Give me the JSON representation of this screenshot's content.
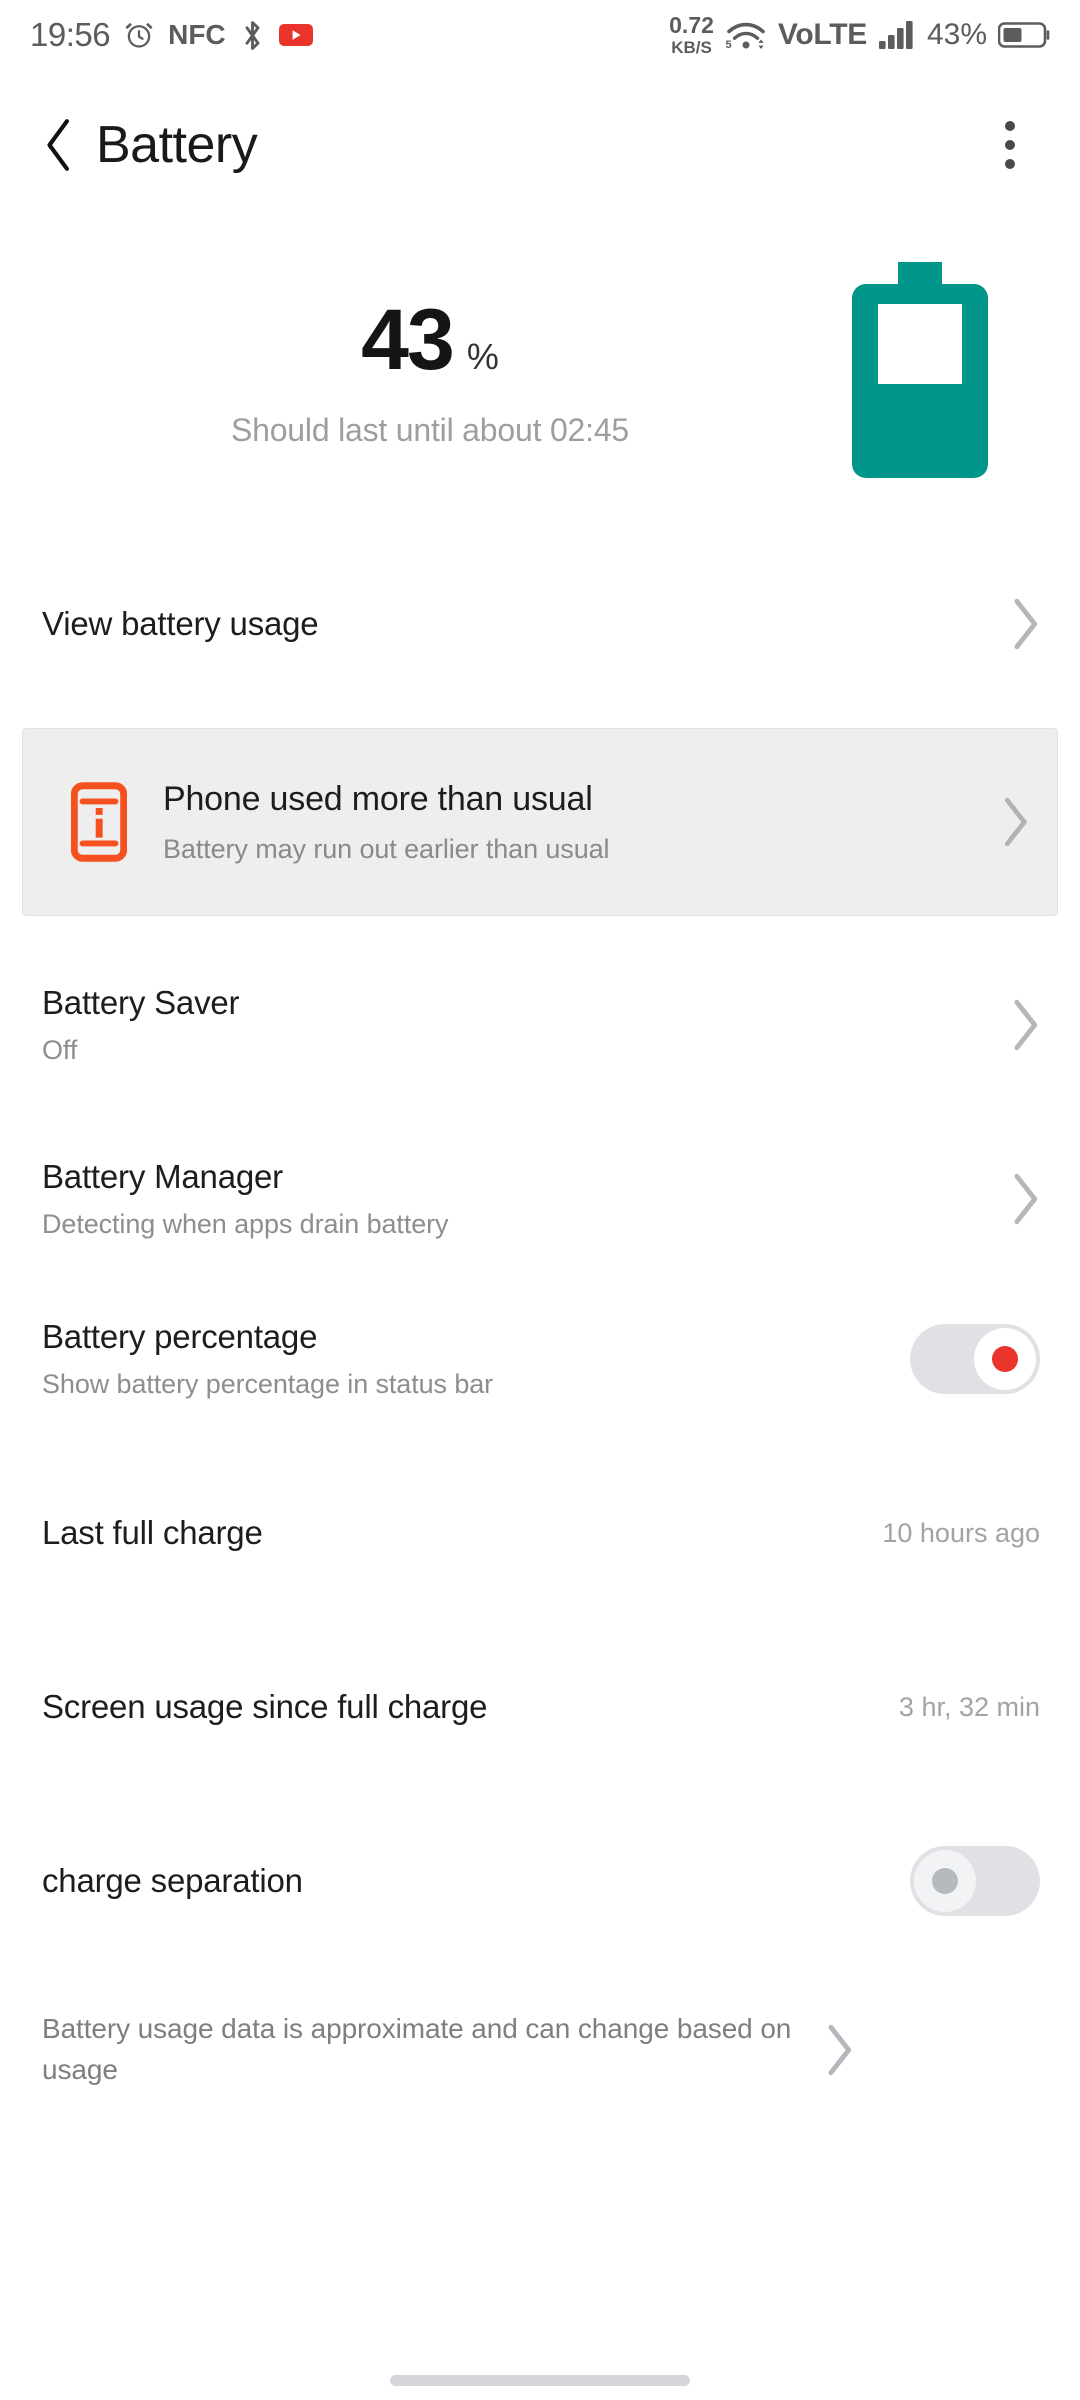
{
  "status_bar": {
    "time": "19:56",
    "alarm_icon": "alarm-clock-icon",
    "nfc_label": "NFC",
    "bluetooth_icon": "bluetooth-icon",
    "youtube_icon": "youtube-icon",
    "net_speed_value": "0.72",
    "net_speed_unit": "KB/S",
    "wifi_icon": "wifi-icon",
    "wifi_band": "5",
    "network_label": "VoLTE",
    "signal_icon": "cellular-signal-icon",
    "battery_percent": "43%",
    "battery_icon": "battery-icon"
  },
  "app_bar": {
    "back_icon": "chevron-left-icon",
    "title": "Battery",
    "overflow_icon": "more-vertical-icon"
  },
  "hero": {
    "percent_value": "43",
    "percent_symbol": "%",
    "estimate": "Should last until about 02:45",
    "battery_graphic": "battery-level-icon",
    "battery_color": "#00968B",
    "battery_fill_ratio": 0.43
  },
  "usage_link": {
    "label": "View battery usage",
    "chevron": "chevron-right-icon"
  },
  "warning_card": {
    "icon": "battery-alert-icon",
    "icon_color": "#F4511E",
    "background": "#EEEEEE",
    "title": "Phone used more than usual",
    "subtitle": "Battery may run out earlier than usual",
    "chevron": "chevron-right-icon"
  },
  "settings": [
    {
      "name": "battery-saver",
      "title": "Battery Saver",
      "subtitle": "Off",
      "type": "link",
      "chevron": "chevron-right-icon"
    },
    {
      "name": "battery-manager",
      "title": "Battery Manager",
      "subtitle": "Detecting when apps drain battery",
      "type": "link",
      "chevron": "chevron-right-icon"
    },
    {
      "name": "battery-percentage",
      "title": "Battery percentage",
      "subtitle": "Show battery percentage in status bar",
      "type": "toggle",
      "toggle_state": "on"
    },
    {
      "name": "last-full-charge",
      "title": "Last full charge",
      "value": "10 hours ago",
      "type": "value"
    },
    {
      "name": "screen-usage-since-full-charge",
      "title": "Screen usage since full charge",
      "value": "3 hr, 32 min",
      "type": "value"
    },
    {
      "name": "charge-separation",
      "title": "charge separation",
      "type": "toggle",
      "toggle_state": "off"
    }
  ],
  "footer": {
    "note": "Battery usage data is approximate and can change based on usage",
    "chevron": "chevron-right-icon"
  },
  "colors": {
    "accent_teal": "#00968B",
    "warning_orange": "#F4511E",
    "toggle_on_dot": "#E8342A",
    "text_primary": "#1D1D1D",
    "text_secondary": "#8E8E8E"
  }
}
